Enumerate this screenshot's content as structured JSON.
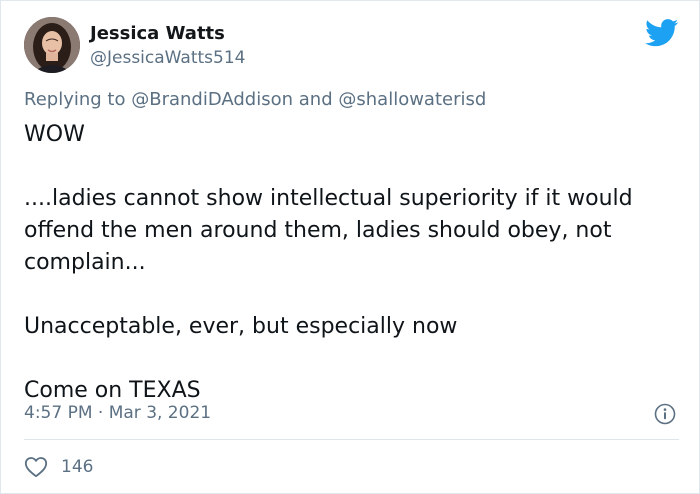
{
  "author": {
    "name": "Jessica Watts",
    "handle": "@JessicaWatts514"
  },
  "reply": {
    "prefix": "Replying to",
    "mention_1": "@BrandiDAddison",
    "conjunction": "and",
    "mention_2": "@shallowaterisd"
  },
  "tweet": {
    "line_1": "WOW",
    "line_2": "....ladies cannot show intellectual superiority if it would offend the men around them, ladies should obey, not complain...",
    "line_3": "Unacceptable, ever, but especially now",
    "line_4": "Come on TEXAS"
  },
  "meta": {
    "timestamp": "4:57 PM · Mar 3, 2021"
  },
  "engagement": {
    "likes": "146"
  },
  "colors": {
    "twitter_blue": "#1da1f2",
    "secondary_text": "#5b7083",
    "primary_text": "#0f1419",
    "divider": "#dfe5ea"
  },
  "icons": {
    "brand": "twitter-bird-icon",
    "info": "info-icon",
    "like": "heart-icon"
  }
}
